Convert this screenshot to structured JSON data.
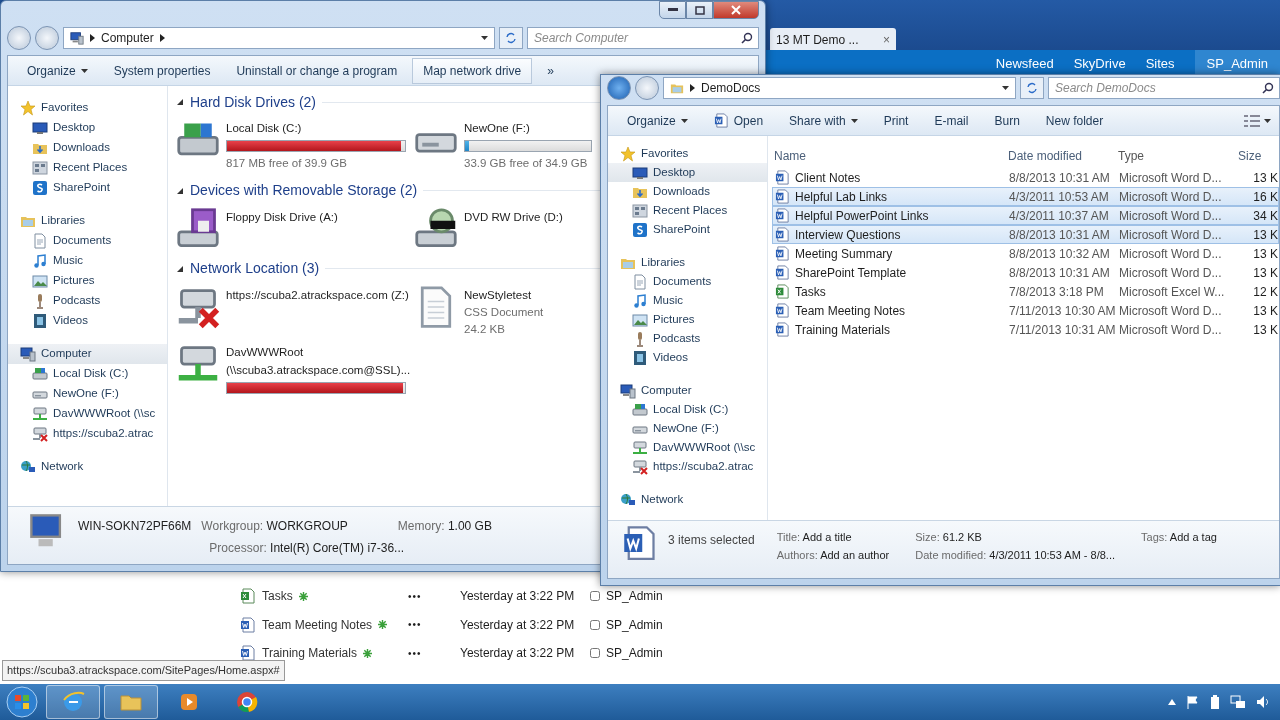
{
  "browser": {
    "tab": {
      "label": "13 MT Demo ...",
      "close": "×"
    },
    "suite_links": [
      "Newsfeed",
      "SkyDrive",
      "Sites"
    ],
    "user": "SP_Admin",
    "documents": [
      {
        "kind": "excel",
        "name": "Tasks",
        "new": true,
        "menu": "•••",
        "modified": "Yesterday at 3:22 PM",
        "checked": false,
        "modified_by": "SP_Admin"
      },
      {
        "kind": "word",
        "name": "Team Meeting Notes",
        "new": true,
        "menu": "•••",
        "modified": "Yesterday at 3:22 PM",
        "checked": false,
        "modified_by": "SP_Admin"
      },
      {
        "kind": "word",
        "name": "Training Materials",
        "new": true,
        "menu": "•••",
        "modified": "Yesterday at 3:22 PM",
        "checked": false,
        "modified_by": "SP_Admin"
      }
    ],
    "status_url": "https://scuba3.atrackspace.com/SitePages/Home.aspx#"
  },
  "computer_window": {
    "address": "Computer",
    "search": {
      "placeholder": "Search Computer"
    },
    "toolbar": [
      {
        "label": "Organize",
        "dropdown": true
      },
      {
        "label": "System properties",
        "dropdown": false
      },
      {
        "label": "Uninstall or change a program",
        "dropdown": false
      },
      {
        "label": "Map network drive",
        "dropdown": false
      }
    ],
    "more": "»",
    "nav": [
      {
        "kind": "star",
        "label": "Favorites",
        "selected": false,
        "children": [
          {
            "kind": "desktop",
            "label": "Desktop",
            "selected": false
          },
          {
            "kind": "downloads",
            "label": "Downloads",
            "selected": false
          },
          {
            "kind": "recent",
            "label": "Recent Places",
            "selected": false
          },
          {
            "kind": "sharepoint",
            "label": "SharePoint",
            "selected": false
          }
        ]
      },
      {
        "kind": "library",
        "label": "Libraries",
        "selected": false,
        "children": [
          {
            "kind": "documents",
            "label": "Documents",
            "selected": false
          },
          {
            "kind": "music",
            "label": "Music",
            "selected": false
          },
          {
            "kind": "pictures",
            "label": "Pictures",
            "selected": false
          },
          {
            "kind": "podcasts",
            "label": "Podcasts",
            "selected": false
          },
          {
            "kind": "videos",
            "label": "Videos",
            "selected": false
          }
        ]
      },
      {
        "kind": "computer",
        "label": "Computer",
        "selected": true,
        "children": [
          {
            "kind": "system-drive",
            "label": "Local Disk (C:)",
            "selected": false
          },
          {
            "kind": "drive",
            "label": "NewOne (F:)",
            "selected": false
          },
          {
            "kind": "net-drive",
            "label": "DavWWWRoot (\\\\sc",
            "selected": false
          },
          {
            "kind": "net-drive-off",
            "label": "https://scuba2.atrac",
            "selected": false
          }
        ]
      },
      {
        "kind": "network",
        "label": "Network",
        "selected": false
      }
    ],
    "groups": [
      {
        "title": "Hard Disk Drives (2)",
        "expanded": true,
        "items": [
          {
            "kind": "system-drive",
            "name": "Local Disk (C:)",
            "level": 0.98,
            "details": [
              "817 MB free of 39.9 GB"
            ]
          },
          {
            "kind": "drive",
            "name": "NewOne (F:)",
            "level": 0.03,
            "details": [
              "33.9 GB free of 34.9 GB"
            ]
          }
        ]
      },
      {
        "title": "Devices with Removable Storage (2)",
        "expanded": true,
        "items": [
          {
            "kind": "floppy",
            "name": "Floppy Disk Drive (A:)"
          },
          {
            "kind": "dvd",
            "name": "DVD RW Drive (D:)"
          }
        ]
      },
      {
        "title": "Network Location (3)",
        "expanded": true,
        "items": [
          {
            "kind": "net-drive-off",
            "name": "https://scuba2.atrackspace.com (Z:)"
          },
          {
            "kind": "file",
            "name": "NewStyletest",
            "details": [
              "CSS Document",
              "24.2 KB"
            ]
          },
          {
            "kind": "net-drive",
            "name": "DavWWWRoot (\\\\scuba3.atrackspace.com@SSL)...",
            "level": 0.99
          }
        ]
      }
    ],
    "details": {
      "name": "WIN-SOKN72PF66M",
      "fields": [
        {
          "label": "Workgroup:",
          "value": "WORKGROUP"
        },
        {
          "label": "Memory:",
          "value": "1.00 GB"
        },
        {
          "label": "Processor:",
          "value": "Intel(R) Core(TM) i7-36..."
        }
      ]
    }
  },
  "docs_window": {
    "address": "DemoDocs",
    "search": {
      "placeholder": "Search DemoDocs"
    },
    "toolbar": [
      {
        "label": "Organize",
        "dropdown": true,
        "kind": "plain"
      },
      {
        "label": "Open",
        "dropdown": false,
        "kind": "word"
      },
      {
        "label": "Share with",
        "dropdown": true,
        "kind": "plain"
      },
      {
        "label": "Print",
        "dropdown": false,
        "kind": "plain"
      },
      {
        "label": "E-mail",
        "dropdown": false,
        "kind": "plain"
      },
      {
        "label": "Burn",
        "dropdown": false,
        "kind": "plain"
      },
      {
        "label": "New folder",
        "dropdown": false,
        "kind": "plain"
      }
    ],
    "nav": [
      {
        "kind": "star",
        "label": "Favorites",
        "selected": false,
        "children": [
          {
            "kind": "desktop",
            "label": "Desktop",
            "selected": true
          },
          {
            "kind": "downloads",
            "label": "Downloads",
            "selected": false
          },
          {
            "kind": "recent",
            "label": "Recent Places",
            "selected": false
          },
          {
            "kind": "sharepoint",
            "label": "SharePoint",
            "selected": false
          }
        ]
      },
      {
        "kind": "library",
        "label": "Libraries",
        "selected": false,
        "children": [
          {
            "kind": "documents",
            "label": "Documents",
            "selected": false
          },
          {
            "kind": "music",
            "label": "Music",
            "selected": false
          },
          {
            "kind": "pictures",
            "label": "Pictures",
            "selected": false
          },
          {
            "kind": "podcasts",
            "label": "Podcasts",
            "selected": false
          },
          {
            "kind": "videos",
            "label": "Videos",
            "selected": false
          }
        ]
      },
      {
        "kind": "computer",
        "label": "Computer",
        "selected": false,
        "children": [
          {
            "kind": "system-drive",
            "label": "Local Disk (C:)",
            "selected": false
          },
          {
            "kind": "drive",
            "label": "NewOne (F:)",
            "selected": false
          },
          {
            "kind": "net-drive",
            "label": "DavWWWRoot (\\\\sc",
            "selected": false
          },
          {
            "kind": "net-drive-off",
            "label": "https://scuba2.atrac",
            "selected": false
          }
        ]
      },
      {
        "kind": "network",
        "label": "Network",
        "selected": false
      }
    ],
    "columns": [
      "Name",
      "Date modified",
      "Type",
      "Size"
    ],
    "rows": [
      {
        "kind": "word",
        "name": "Client Notes",
        "modified": "8/8/2013 10:31 AM",
        "type": "Microsoft Word D...",
        "size": "13 K",
        "selected": false
      },
      {
        "kind": "word",
        "name": "Helpful Lab Links",
        "modified": "4/3/2011 10:53 AM",
        "type": "Microsoft Word D...",
        "size": "16 K",
        "selected": true
      },
      {
        "kind": "word",
        "name": "Helpful PowerPoint Links",
        "modified": "4/3/2011 10:37 AM",
        "type": "Microsoft Word D...",
        "size": "34 K",
        "selected": true
      },
      {
        "kind": "word",
        "name": "Interview Questions",
        "modified": "8/8/2013 10:31 AM",
        "type": "Microsoft Word D...",
        "size": "13 K",
        "selected": true
      },
      {
        "kind": "word",
        "name": "Meeting Summary",
        "modified": "8/8/2013 10:32 AM",
        "type": "Microsoft Word D...",
        "size": "13 K",
        "selected": false
      },
      {
        "kind": "word",
        "name": "SharePoint Template",
        "modified": "8/8/2013 10:31 AM",
        "type": "Microsoft Word D...",
        "size": "13 K",
        "selected": false
      },
      {
        "kind": "excel",
        "name": "Tasks",
        "modified": "7/8/2013 3:18 PM",
        "type": "Microsoft Excel W...",
        "size": "12 K",
        "selected": false
      },
      {
        "kind": "word",
        "name": "Team Meeting Notes",
        "modified": "7/11/2013 10:30 AM",
        "type": "Microsoft Word D...",
        "size": "13 K",
        "selected": false
      },
      {
        "kind": "word",
        "name": "Training Materials",
        "modified": "7/11/2013 10:31 AM",
        "type": "Microsoft Word D...",
        "size": "13 K",
        "selected": false
      }
    ],
    "details": {
      "summary": "3 items selected",
      "fields": [
        {
          "label": "Title:",
          "value": "Add a title"
        },
        {
          "label": "Authors:",
          "value": "Add an author"
        },
        {
          "label": "Size:",
          "value": "61.2 KB"
        },
        {
          "label": "Date modified:",
          "value": "4/3/2011 10:53 AM - 8/8..."
        },
        {
          "label": "Tags:",
          "value": "Add a tag"
        }
      ]
    }
  },
  "taskbar": {
    "apps": [
      {
        "kind": "browser",
        "running": true
      },
      {
        "kind": "folder",
        "running": true
      },
      {
        "kind": "media",
        "running": false
      },
      {
        "kind": "chrome",
        "running": false
      }
    ]
  }
}
